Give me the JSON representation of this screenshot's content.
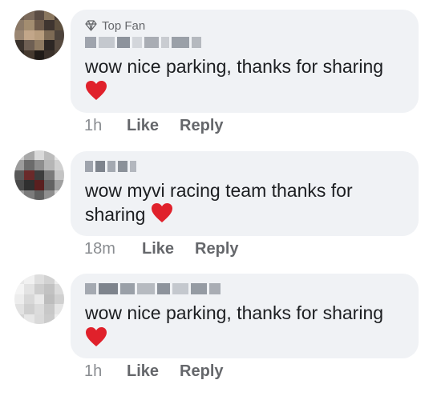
{
  "colors": {
    "bubble": "#f0f2f5",
    "meta_text": "#65676b",
    "heart": "#e0212b"
  },
  "comments": [
    {
      "badge_icon": "diamond-icon",
      "badge_label": "Top Fan",
      "author_blurred": true,
      "text": "wow nice parking, thanks for sharing",
      "emoji": "heart-emoji",
      "time": "1h",
      "like_label": "Like",
      "reply_label": "Reply"
    },
    {
      "author_blurred": true,
      "text": "wow myvi racing team thanks for sharing",
      "emoji": "heart-emoji",
      "time": "18m",
      "like_label": "Like",
      "reply_label": "Reply"
    },
    {
      "author_blurred": true,
      "text": "wow nice parking, thanks for sharing",
      "emoji": "heart-emoji",
      "time": "1h",
      "like_label": "Like",
      "reply_label": "Reply"
    }
  ]
}
